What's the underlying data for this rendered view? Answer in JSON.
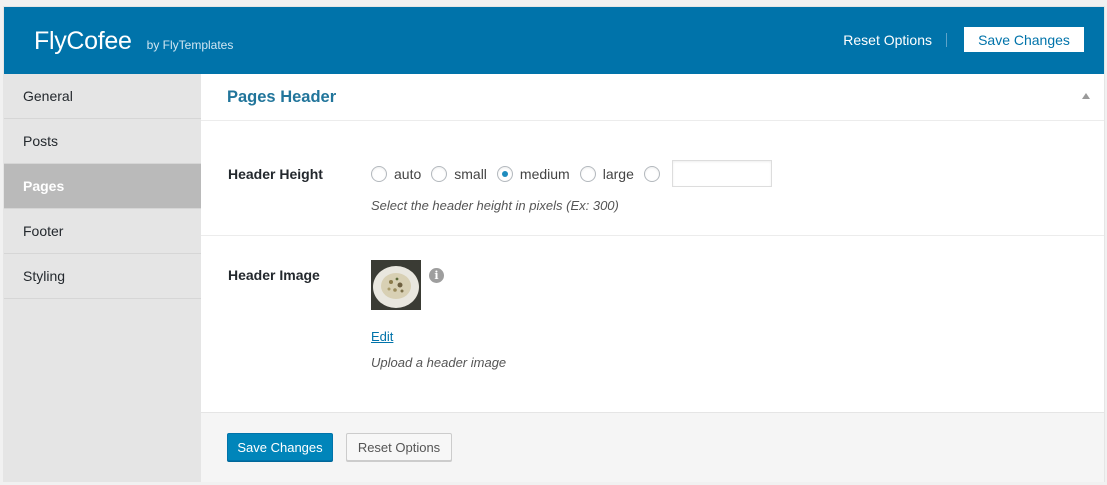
{
  "header": {
    "title": "FlyCofee",
    "byline": "by FlyTemplates",
    "reset_label": "Reset Options",
    "save_label": "Save Changes"
  },
  "sidebar": {
    "items": [
      {
        "label": "General",
        "active": false
      },
      {
        "label": "Posts",
        "active": false
      },
      {
        "label": "Pages",
        "active": true
      },
      {
        "label": "Footer",
        "active": false
      },
      {
        "label": "Styling",
        "active": false
      }
    ]
  },
  "section": {
    "title": "Pages Header"
  },
  "header_height": {
    "label": "Header Height",
    "options": [
      "auto",
      "small",
      "medium",
      "large"
    ],
    "selected": "medium",
    "custom_value": "",
    "description": "Select the header height in pixels (Ex: 300)"
  },
  "header_image": {
    "label": "Header Image",
    "edit_label": "Edit",
    "description": "Upload a header image"
  },
  "footer": {
    "save_label": "Save Changes",
    "reset_label": "Reset Options"
  },
  "colors": {
    "topbar": "#0073aa",
    "primary_button": "#0085ba",
    "section_title": "#21759b",
    "active_sidebar": "#bababa"
  }
}
